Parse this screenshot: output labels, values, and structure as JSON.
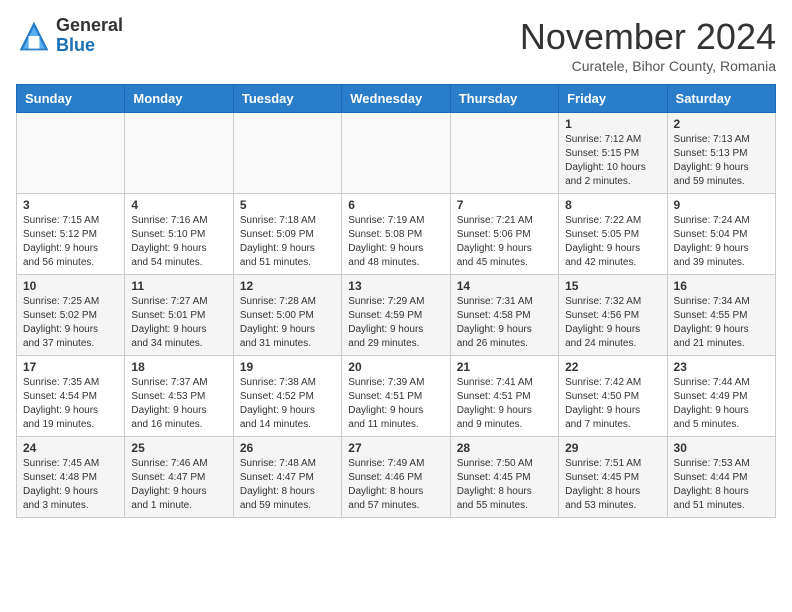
{
  "header": {
    "logo_general": "General",
    "logo_blue": "Blue",
    "month_title": "November 2024",
    "location": "Curatele, Bihor County, Romania"
  },
  "days_of_week": [
    "Sunday",
    "Monday",
    "Tuesday",
    "Wednesday",
    "Thursday",
    "Friday",
    "Saturday"
  ],
  "weeks": [
    [
      {
        "day": "",
        "info": ""
      },
      {
        "day": "",
        "info": ""
      },
      {
        "day": "",
        "info": ""
      },
      {
        "day": "",
        "info": ""
      },
      {
        "day": "",
        "info": ""
      },
      {
        "day": "1",
        "info": "Sunrise: 7:12 AM\nSunset: 5:15 PM\nDaylight: 10 hours\nand 2 minutes."
      },
      {
        "day": "2",
        "info": "Sunrise: 7:13 AM\nSunset: 5:13 PM\nDaylight: 9 hours\nand 59 minutes."
      }
    ],
    [
      {
        "day": "3",
        "info": "Sunrise: 7:15 AM\nSunset: 5:12 PM\nDaylight: 9 hours\nand 56 minutes."
      },
      {
        "day": "4",
        "info": "Sunrise: 7:16 AM\nSunset: 5:10 PM\nDaylight: 9 hours\nand 54 minutes."
      },
      {
        "day": "5",
        "info": "Sunrise: 7:18 AM\nSunset: 5:09 PM\nDaylight: 9 hours\nand 51 minutes."
      },
      {
        "day": "6",
        "info": "Sunrise: 7:19 AM\nSunset: 5:08 PM\nDaylight: 9 hours\nand 48 minutes."
      },
      {
        "day": "7",
        "info": "Sunrise: 7:21 AM\nSunset: 5:06 PM\nDaylight: 9 hours\nand 45 minutes."
      },
      {
        "day": "8",
        "info": "Sunrise: 7:22 AM\nSunset: 5:05 PM\nDaylight: 9 hours\nand 42 minutes."
      },
      {
        "day": "9",
        "info": "Sunrise: 7:24 AM\nSunset: 5:04 PM\nDaylight: 9 hours\nand 39 minutes."
      }
    ],
    [
      {
        "day": "10",
        "info": "Sunrise: 7:25 AM\nSunset: 5:02 PM\nDaylight: 9 hours\nand 37 minutes."
      },
      {
        "day": "11",
        "info": "Sunrise: 7:27 AM\nSunset: 5:01 PM\nDaylight: 9 hours\nand 34 minutes."
      },
      {
        "day": "12",
        "info": "Sunrise: 7:28 AM\nSunset: 5:00 PM\nDaylight: 9 hours\nand 31 minutes."
      },
      {
        "day": "13",
        "info": "Sunrise: 7:29 AM\nSunset: 4:59 PM\nDaylight: 9 hours\nand 29 minutes."
      },
      {
        "day": "14",
        "info": "Sunrise: 7:31 AM\nSunset: 4:58 PM\nDaylight: 9 hours\nand 26 minutes."
      },
      {
        "day": "15",
        "info": "Sunrise: 7:32 AM\nSunset: 4:56 PM\nDaylight: 9 hours\nand 24 minutes."
      },
      {
        "day": "16",
        "info": "Sunrise: 7:34 AM\nSunset: 4:55 PM\nDaylight: 9 hours\nand 21 minutes."
      }
    ],
    [
      {
        "day": "17",
        "info": "Sunrise: 7:35 AM\nSunset: 4:54 PM\nDaylight: 9 hours\nand 19 minutes."
      },
      {
        "day": "18",
        "info": "Sunrise: 7:37 AM\nSunset: 4:53 PM\nDaylight: 9 hours\nand 16 minutes."
      },
      {
        "day": "19",
        "info": "Sunrise: 7:38 AM\nSunset: 4:52 PM\nDaylight: 9 hours\nand 14 minutes."
      },
      {
        "day": "20",
        "info": "Sunrise: 7:39 AM\nSunset: 4:51 PM\nDaylight: 9 hours\nand 11 minutes."
      },
      {
        "day": "21",
        "info": "Sunrise: 7:41 AM\nSunset: 4:51 PM\nDaylight: 9 hours\nand 9 minutes."
      },
      {
        "day": "22",
        "info": "Sunrise: 7:42 AM\nSunset: 4:50 PM\nDaylight: 9 hours\nand 7 minutes."
      },
      {
        "day": "23",
        "info": "Sunrise: 7:44 AM\nSunset: 4:49 PM\nDaylight: 9 hours\nand 5 minutes."
      }
    ],
    [
      {
        "day": "24",
        "info": "Sunrise: 7:45 AM\nSunset: 4:48 PM\nDaylight: 9 hours\nand 3 minutes."
      },
      {
        "day": "25",
        "info": "Sunrise: 7:46 AM\nSunset: 4:47 PM\nDaylight: 9 hours\nand 1 minute."
      },
      {
        "day": "26",
        "info": "Sunrise: 7:48 AM\nSunset: 4:47 PM\nDaylight: 8 hours\nand 59 minutes."
      },
      {
        "day": "27",
        "info": "Sunrise: 7:49 AM\nSunset: 4:46 PM\nDaylight: 8 hours\nand 57 minutes."
      },
      {
        "day": "28",
        "info": "Sunrise: 7:50 AM\nSunset: 4:45 PM\nDaylight: 8 hours\nand 55 minutes."
      },
      {
        "day": "29",
        "info": "Sunrise: 7:51 AM\nSunset: 4:45 PM\nDaylight: 8 hours\nand 53 minutes."
      },
      {
        "day": "30",
        "info": "Sunrise: 7:53 AM\nSunset: 4:44 PM\nDaylight: 8 hours\nand 51 minutes."
      }
    ]
  ]
}
